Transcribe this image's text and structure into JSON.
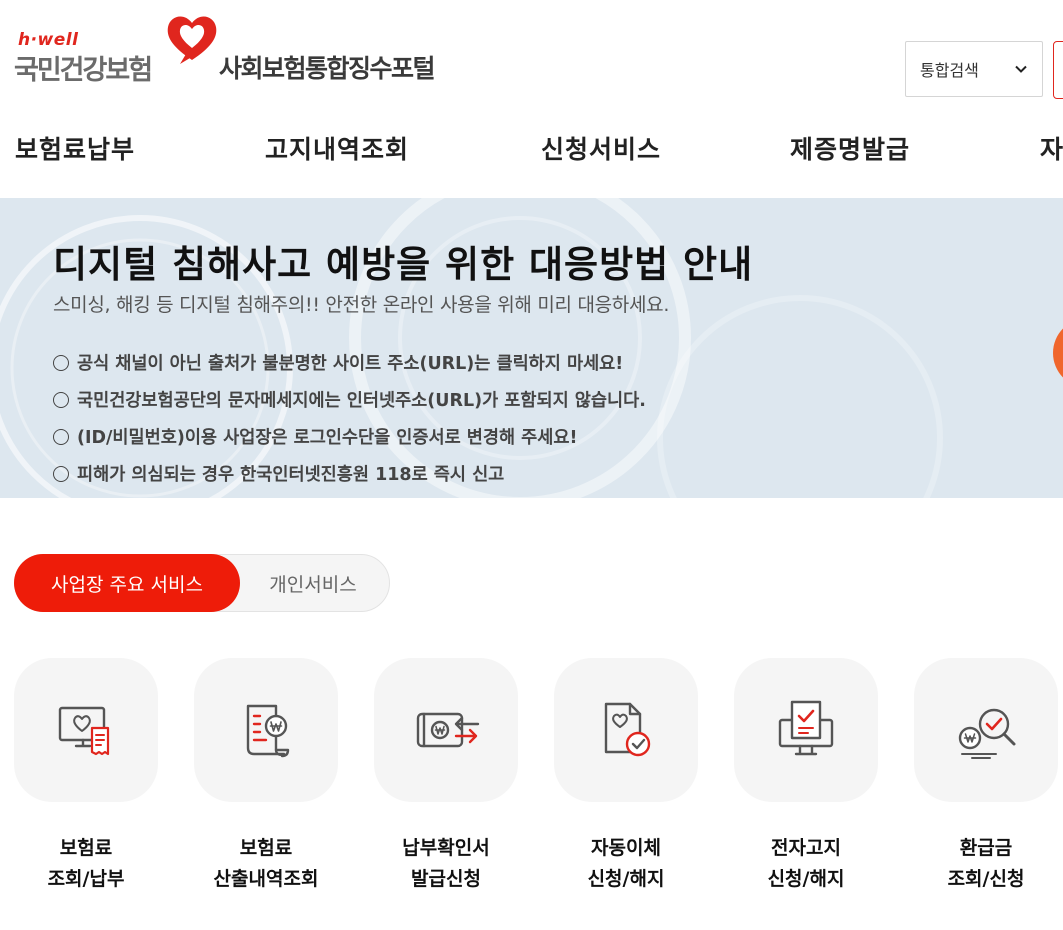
{
  "header": {
    "logo_tag": "h·well",
    "logo_name": "국민건강보험",
    "portal_title": "사회보험통합징수포털",
    "search_select_value": "통합검색"
  },
  "nav": {
    "items": [
      "보험료납부",
      "고지내역조회",
      "신청서비스",
      "제증명발급",
      "자"
    ]
  },
  "banner": {
    "title": "디지털 침해사고 예방을 위한 대응방법 안내",
    "subtitle": "스미싱, 해킹 등 디지털 침해주의!! 안전한 온라인 사용을 위해 미리 대응하세요.",
    "bullets": [
      "공식 채널이 아닌 출처가 불분명한 사이트 주소(URL)는 클릭하지 마세요!",
      "국민건강보험공단의 문자메세지에는 인터넷주소(URL)가 포함되지 않습니다.",
      "(ID/비밀번호)이용 사업장은 로그인수단을 인증서로 변경해 주세요!",
      "피해가 의심되는 경우 한국인터넷진흥원 118로 즉시 신고"
    ],
    "background_color": "#dde7ef"
  },
  "tabs": {
    "active": "사업장 주요 서비스",
    "inactive": "개인서비스",
    "active_color": "#ee1c09"
  },
  "services": [
    {
      "line1": "보험료",
      "line2": "조회/납부",
      "icon": "monitor-heart-receipt-icon"
    },
    {
      "line1": "보험료",
      "line2": "산출내역조회",
      "icon": "document-won-icon"
    },
    {
      "line1": "납부확인서",
      "line2": "발급신청",
      "icon": "wallet-transfer-icon"
    },
    {
      "line1": "자동이체",
      "line2": "신청/해지",
      "icon": "file-heart-check-icon"
    },
    {
      "line1": "전자고지",
      "line2": "신청/해지",
      "icon": "monitor-document-check-icon"
    },
    {
      "line1": "환급금",
      "line2": "조회/신청",
      "icon": "coin-magnifier-check-icon"
    }
  ],
  "colors": {
    "brand_red": "#e0261e",
    "icon_gray": "#555555",
    "icon_red": "#e0261e"
  }
}
